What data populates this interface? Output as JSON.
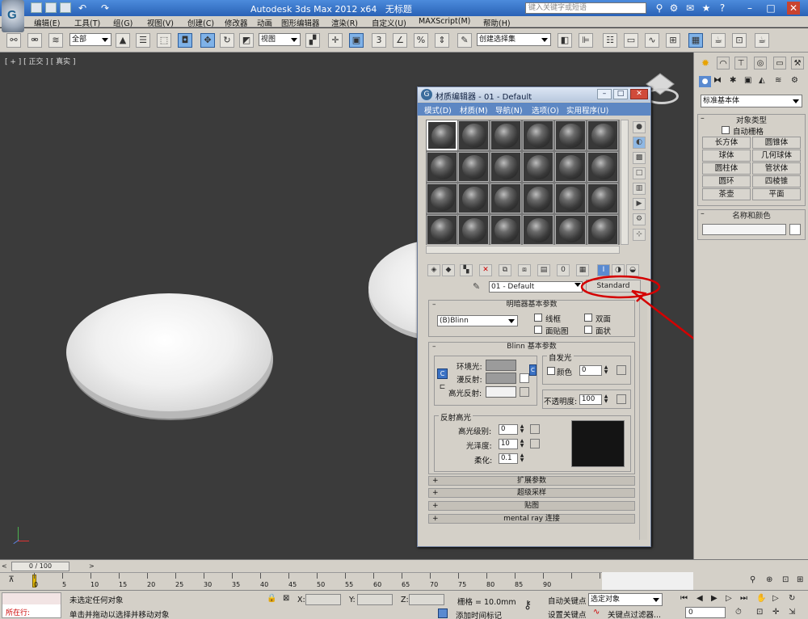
{
  "title_bar": {
    "app_title": "Autodesk 3ds Max  2012 x64",
    "document": "无标题",
    "search_placeholder": "键入关键字或短语"
  },
  "menu_bar": {
    "items": [
      "编辑(E)",
      "工具(T)",
      "组(G)",
      "视图(V)",
      "创建(C)",
      "修改器",
      "动画",
      "图形编辑器",
      "渲染(R)",
      "自定义(U)",
      "MAXScript(M)",
      "帮助(H)"
    ]
  },
  "toolbar": {
    "selection_filter": "全部",
    "reference_coord": "视图",
    "named_selection": "创建选择集"
  },
  "viewport": {
    "label": "[ + ] [ 正交 ] [ 真实 ]"
  },
  "material_editor": {
    "title": "材质编辑器 - 01 - Default",
    "menu": [
      "模式(D)",
      "材质(M)",
      "导航(N)",
      "选项(O)",
      "实用程序(U)"
    ],
    "material_name": "01 - Default",
    "material_type_button": "Standard",
    "shader_basic": {
      "header": "明暗器基本参数",
      "shader": "(B)Blinn",
      "options": [
        "线框",
        "双面",
        "面贴图",
        "面状"
      ]
    },
    "blinn_basic": {
      "header": "Blinn 基本参数",
      "self_illum_group": "自发光",
      "color_label": "颜色",
      "color_value": "0",
      "ambient": "环境光:",
      "diffuse": "漫反射:",
      "specular": "高光反射:",
      "opacity_label": "不透明度:",
      "opacity_value": "100",
      "ambient_color": "#9b9b9b",
      "diffuse_color": "#9b9b9b",
      "specular_color": "#f2f2f2"
    },
    "highlights": {
      "header": "反射高光",
      "spec_level_label": "高光级别:",
      "spec_level": "0",
      "glossiness_label": "光泽度:",
      "glossiness": "10",
      "soften_label": "柔化:",
      "soften": "0.1"
    },
    "collapsed_rollouts": [
      "扩展参数",
      "超级采样",
      "贴图",
      "mental ray 连接"
    ]
  },
  "command_panel": {
    "category": "标准基本体",
    "object_type_header": "对象类型",
    "autogrid": "自动栅格",
    "buttons": [
      "长方体",
      "圆锥体",
      "球体",
      "几何球体",
      "圆柱体",
      "管状体",
      "圆环",
      "四棱锥",
      "茶壶",
      "平面"
    ],
    "name_color_header": "名称和颜色"
  },
  "timeline": {
    "frame_slider": "0 / 100",
    "ticks": [
      "0",
      "5",
      "10",
      "15",
      "20",
      "25",
      "30",
      "35",
      "40",
      "45",
      "50",
      "55",
      "60",
      "65",
      "70",
      "75",
      "80",
      "85",
      "90"
    ]
  },
  "status_bar": {
    "script_label": "所在行:",
    "prompt1": "未选定任何对象",
    "prompt2": "单击并拖动以选择并移动对象",
    "x_label": "X:",
    "y_label": "Y:",
    "z_label": "Z:",
    "grid": "栅格 = 10.0mm",
    "add_time_tag": "添加时间标记",
    "auto_key": "自动关键点",
    "selected_option": "选定对象",
    "set_key": "设置关键点",
    "key_filters": "关键点过滤器...",
    "frame": "0"
  },
  "annotation_color": "#d40000"
}
